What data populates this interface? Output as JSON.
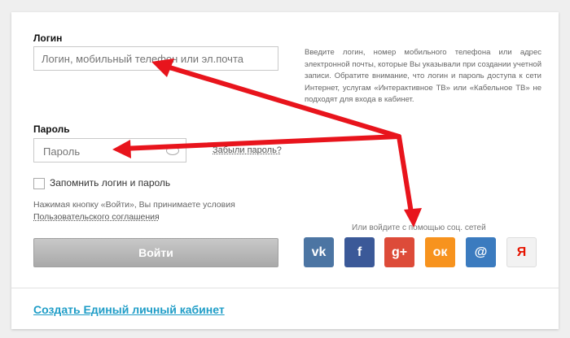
{
  "login": {
    "label": "Логин",
    "placeholder": "Логин, мобильный телефон или эл.почта"
  },
  "password": {
    "label": "Пароль",
    "placeholder": "Пароль",
    "forgot_link": "Забыли пароль?"
  },
  "remember": {
    "label": "Запомнить логин и пароль",
    "checked": false
  },
  "terms": {
    "text": "Нажимая кнопку «Войти», Вы принимаете условия",
    "link": "Пользовательского соглашения"
  },
  "login_button": "Войти",
  "info_text": "Введите логин, номер мобильного телефона или адрес электронной почты, которые Вы указывали при создании учетной записи. Обратите внимание, что логин и пароль доступа к сети Интернет, услугам «Интерактивное ТВ» или «Кабельное ТВ» не подходят для входа в кабинет.",
  "social": {
    "title": "Или войдите с помощью соц. сетей",
    "buttons": [
      {
        "icon": "vk-icon",
        "glyph": "vk",
        "color": "#4c75a3"
      },
      {
        "icon": "facebook-icon",
        "glyph": "f",
        "color": "#3b5998"
      },
      {
        "icon": "google-plus-icon",
        "glyph": "g+",
        "color": "#dd4b39"
      },
      {
        "icon": "odnoklassniki-icon",
        "glyph": "ок",
        "color": "#f7931e"
      },
      {
        "icon": "mail-ru-icon",
        "glyph": "@",
        "color": "#3b7bbf"
      },
      {
        "icon": "yandex-icon",
        "glyph": "Я",
        "color": "#f2f2f2"
      }
    ]
  },
  "create_account_link": "Создать Единый личный кабинет",
  "colors": {
    "accent_link": "#1f9dc7",
    "annotation_arrow": "#e8141c"
  }
}
